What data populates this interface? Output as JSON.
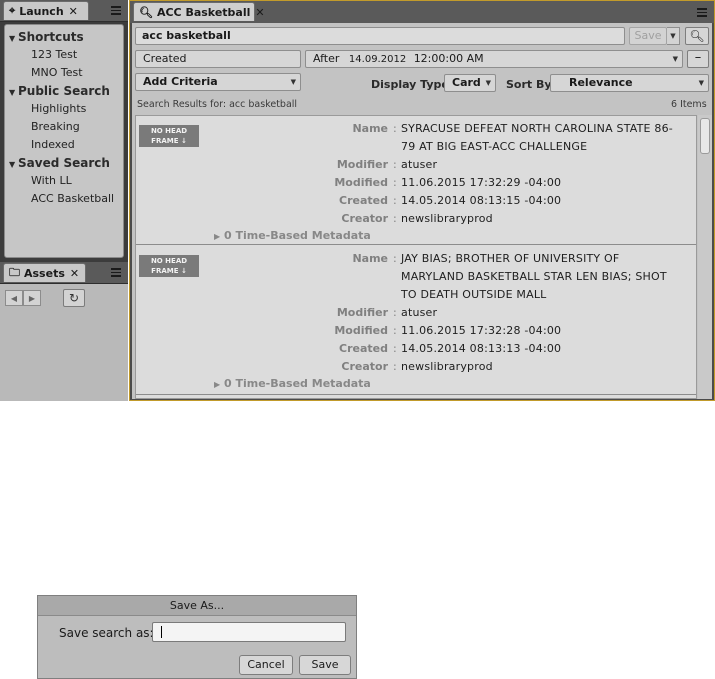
{
  "launch": {
    "tab_label": "Launch",
    "sections": [
      {
        "title": "Shortcuts",
        "items": [
          "123 Test",
          "MNO Test"
        ]
      },
      {
        "title": "Public Search",
        "items": [
          "Highlights",
          "Breaking",
          "Indexed"
        ]
      },
      {
        "title": "Saved Search",
        "items": [
          "With LL",
          "ACC Basketball"
        ]
      }
    ]
  },
  "assets": {
    "tab_label": "Assets"
  },
  "main": {
    "tab_label": "ACC Basketball",
    "search_query": "acc basketball",
    "save_label": "Save",
    "criteria": {
      "field": "Created",
      "operator": "After",
      "date": "14.09.2012",
      "time": "12:00:00 AM"
    },
    "add_criteria_label": "Add Criteria",
    "display_type_label": "Display Type:",
    "display_type_value": "Card",
    "sort_by_label": "Sort By:",
    "sort_by_value": "Relevance",
    "results_for_label": "Search Results for:",
    "results_for_query": "acc basketball",
    "item_count": "6 Items",
    "thumbnail_text_line1": "NO HEAD",
    "thumbnail_text_line2": "FRAME",
    "keys": {
      "name": "Name",
      "modifier": "Modifier",
      "modified": "Modified",
      "created": "Created",
      "creator": "Creator"
    },
    "results": [
      {
        "name_lines": [
          "SYRACUSE DEFEAT NORTH CAROLINA STATE 86-",
          "79 AT BIG EAST-ACC CHALLENGE"
        ],
        "modifier": "atuser",
        "modified": "11.06.2015 17:32:29 -04:00",
        "created": "14.05.2014 08:13:15 -04:00",
        "creator": "newslibraryprod",
        "time_based": "0 Time-Based Metadata"
      },
      {
        "name_lines": [
          "JAY BIAS; BROTHER OF UNIVERSITY OF",
          "MARYLAND BASKETBALL STAR LEN BIAS; SHOT",
          "TO DEATH OUTSIDE MALL"
        ],
        "modifier": "atuser",
        "modified": "11.06.2015 17:32:28 -04:00",
        "created": "14.05.2014 08:13:13 -04:00",
        "creator": "newslibraryprod",
        "time_based": "0 Time-Based Metadata"
      }
    ]
  },
  "dialog": {
    "title": "Save As...",
    "label": "Save search as:",
    "input_value": "",
    "cancel_label": "Cancel",
    "save_label": "Save"
  }
}
